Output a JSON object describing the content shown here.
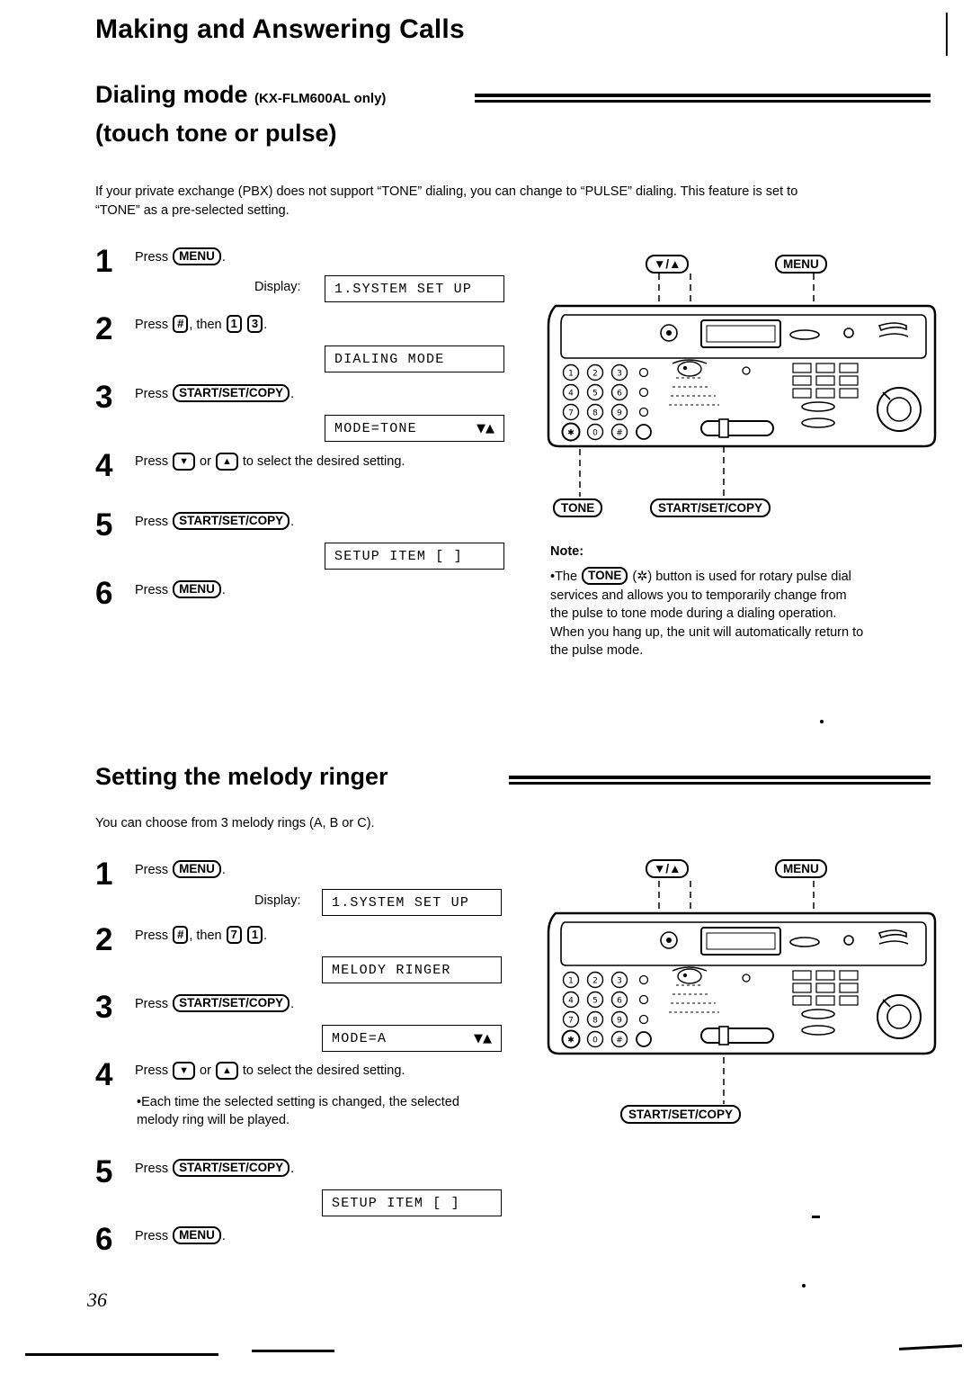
{
  "page": {
    "title": "Making and Answering Calls",
    "number": "36"
  },
  "section1": {
    "heading_line1": "Dialing mode",
    "heading_sub": "(KX-FLM600AL only)",
    "heading_line2": "(touch tone or pulse)",
    "intro": "If your private exchange (PBX) does not support “TONE” dialing, you can change to “PULSE” dialing. This feature is set to “TONE” as a pre-selected setting.",
    "steps": [
      {
        "num": "1",
        "pre": "Press",
        "key": "MENU",
        "post": "."
      },
      {
        "num": "2",
        "pre": "Press",
        "key": "#",
        "mid": ", then",
        "key2": "1",
        "key3": "3",
        "post": "."
      },
      {
        "num": "3",
        "pre": "Press",
        "key": "START/SET/COPY",
        "post": "."
      },
      {
        "num": "4",
        "pre": "Press",
        "key": "▼",
        "mid": "or",
        "key2": "▲",
        "post": "to select the desired setting."
      },
      {
        "num": "5",
        "pre": "Press",
        "key": "START/SET/COPY",
        "post": "."
      },
      {
        "num": "6",
        "pre": "Press",
        "key": "MENU",
        "post": "."
      }
    ],
    "display_label": "Display:",
    "lcd": [
      {
        "text": "1.SYSTEM SET UP",
        "arrows": ""
      },
      {
        "text": "DIALING MODE",
        "arrows": ""
      },
      {
        "text": "MODE=TONE",
        "arrows": "▼▲"
      },
      {
        "text": "SETUP ITEM [  ]",
        "arrows": ""
      }
    ],
    "diagram": {
      "callout_updown": "▼/▲",
      "callout_menu": "MENU",
      "callout_tone": "TONE",
      "callout_startsetcopy": "START/SET/COPY",
      "keypad_rows": [
        [
          "1",
          "2",
          "3"
        ],
        [
          "4",
          "5",
          "6"
        ],
        [
          "7",
          "8",
          "9"
        ],
        [
          "✲",
          "0",
          "#"
        ]
      ]
    },
    "note": {
      "title": "Note:",
      "bullet": "•",
      "text_before": "The",
      "key": "TONE",
      "text_after": "(✲) button is used for rotary pulse dial services and allows you to temporarily change from the pulse to tone mode during a dialing operation. When you hang up, the unit will automatically return to the pulse mode."
    }
  },
  "section2": {
    "heading": "Setting the melody ringer",
    "intro": "You can choose from 3 melody rings (A, B or C).",
    "steps": [
      {
        "num": "1",
        "pre": "Press",
        "key": "MENU",
        "post": "."
      },
      {
        "num": "2",
        "pre": "Press",
        "key": "#",
        "mid": ", then",
        "key2": "7",
        "key3": "1",
        "post": "."
      },
      {
        "num": "3",
        "pre": "Press",
        "key": "START/SET/COPY",
        "post": "."
      },
      {
        "num": "4",
        "pre": "Press",
        "key": "▼",
        "mid": "or",
        "key2": "▲",
        "post": "to select the desired setting."
      },
      {
        "num": "5",
        "pre": "Press",
        "key": "START/SET/COPY",
        "post": "."
      },
      {
        "num": "6",
        "pre": "Press",
        "key": "MENU",
        "post": "."
      }
    ],
    "step4_bullet": "•",
    "step4_note": "Each time the selected setting is changed, the selected melody ring will be played.",
    "display_label": "Display:",
    "lcd": [
      {
        "text": "1.SYSTEM SET UP",
        "arrows": ""
      },
      {
        "text": "MELODY RINGER",
        "arrows": ""
      },
      {
        "text": "MODE=A",
        "arrows": "▼▲"
      },
      {
        "text": "SETUP ITEM [  ]",
        "arrows": ""
      }
    ],
    "diagram": {
      "callout_updown": "▼/▲",
      "callout_menu": "MENU",
      "callout_startsetcopy": "START/SET/COPY",
      "keypad_rows": [
        [
          "1",
          "2",
          "3"
        ],
        [
          "4",
          "5",
          "6"
        ],
        [
          "7",
          "8",
          "9"
        ],
        [
          "✲",
          "0",
          "#"
        ]
      ]
    }
  }
}
